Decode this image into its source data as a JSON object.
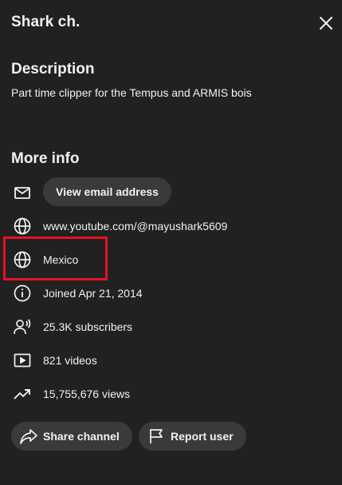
{
  "header": {
    "title": "Shark ch."
  },
  "description": {
    "heading": "Description",
    "text": "Part time clipper for the Tempus and ARMIS bois"
  },
  "more_info": {
    "heading": "More info",
    "view_email_label": "View email address",
    "items": [
      {
        "icon": "globe-icon",
        "text": "www.youtube.com/@mayushark5609"
      },
      {
        "icon": "globe-icon",
        "text": "Mexico"
      },
      {
        "icon": "info-icon",
        "text": "Joined Apr 21, 2014"
      },
      {
        "icon": "subscribers-icon",
        "text": "25.3K subscribers"
      },
      {
        "icon": "video-icon",
        "text": "821 videos"
      },
      {
        "icon": "trending-icon",
        "text": "15,755,676 views"
      }
    ]
  },
  "actions": {
    "share_label": "Share channel",
    "report_label": "Report user"
  },
  "colors": {
    "background": "#212121",
    "pill": "#3a3a3a",
    "text": "#f1f1f1",
    "highlight": "#e81123"
  }
}
